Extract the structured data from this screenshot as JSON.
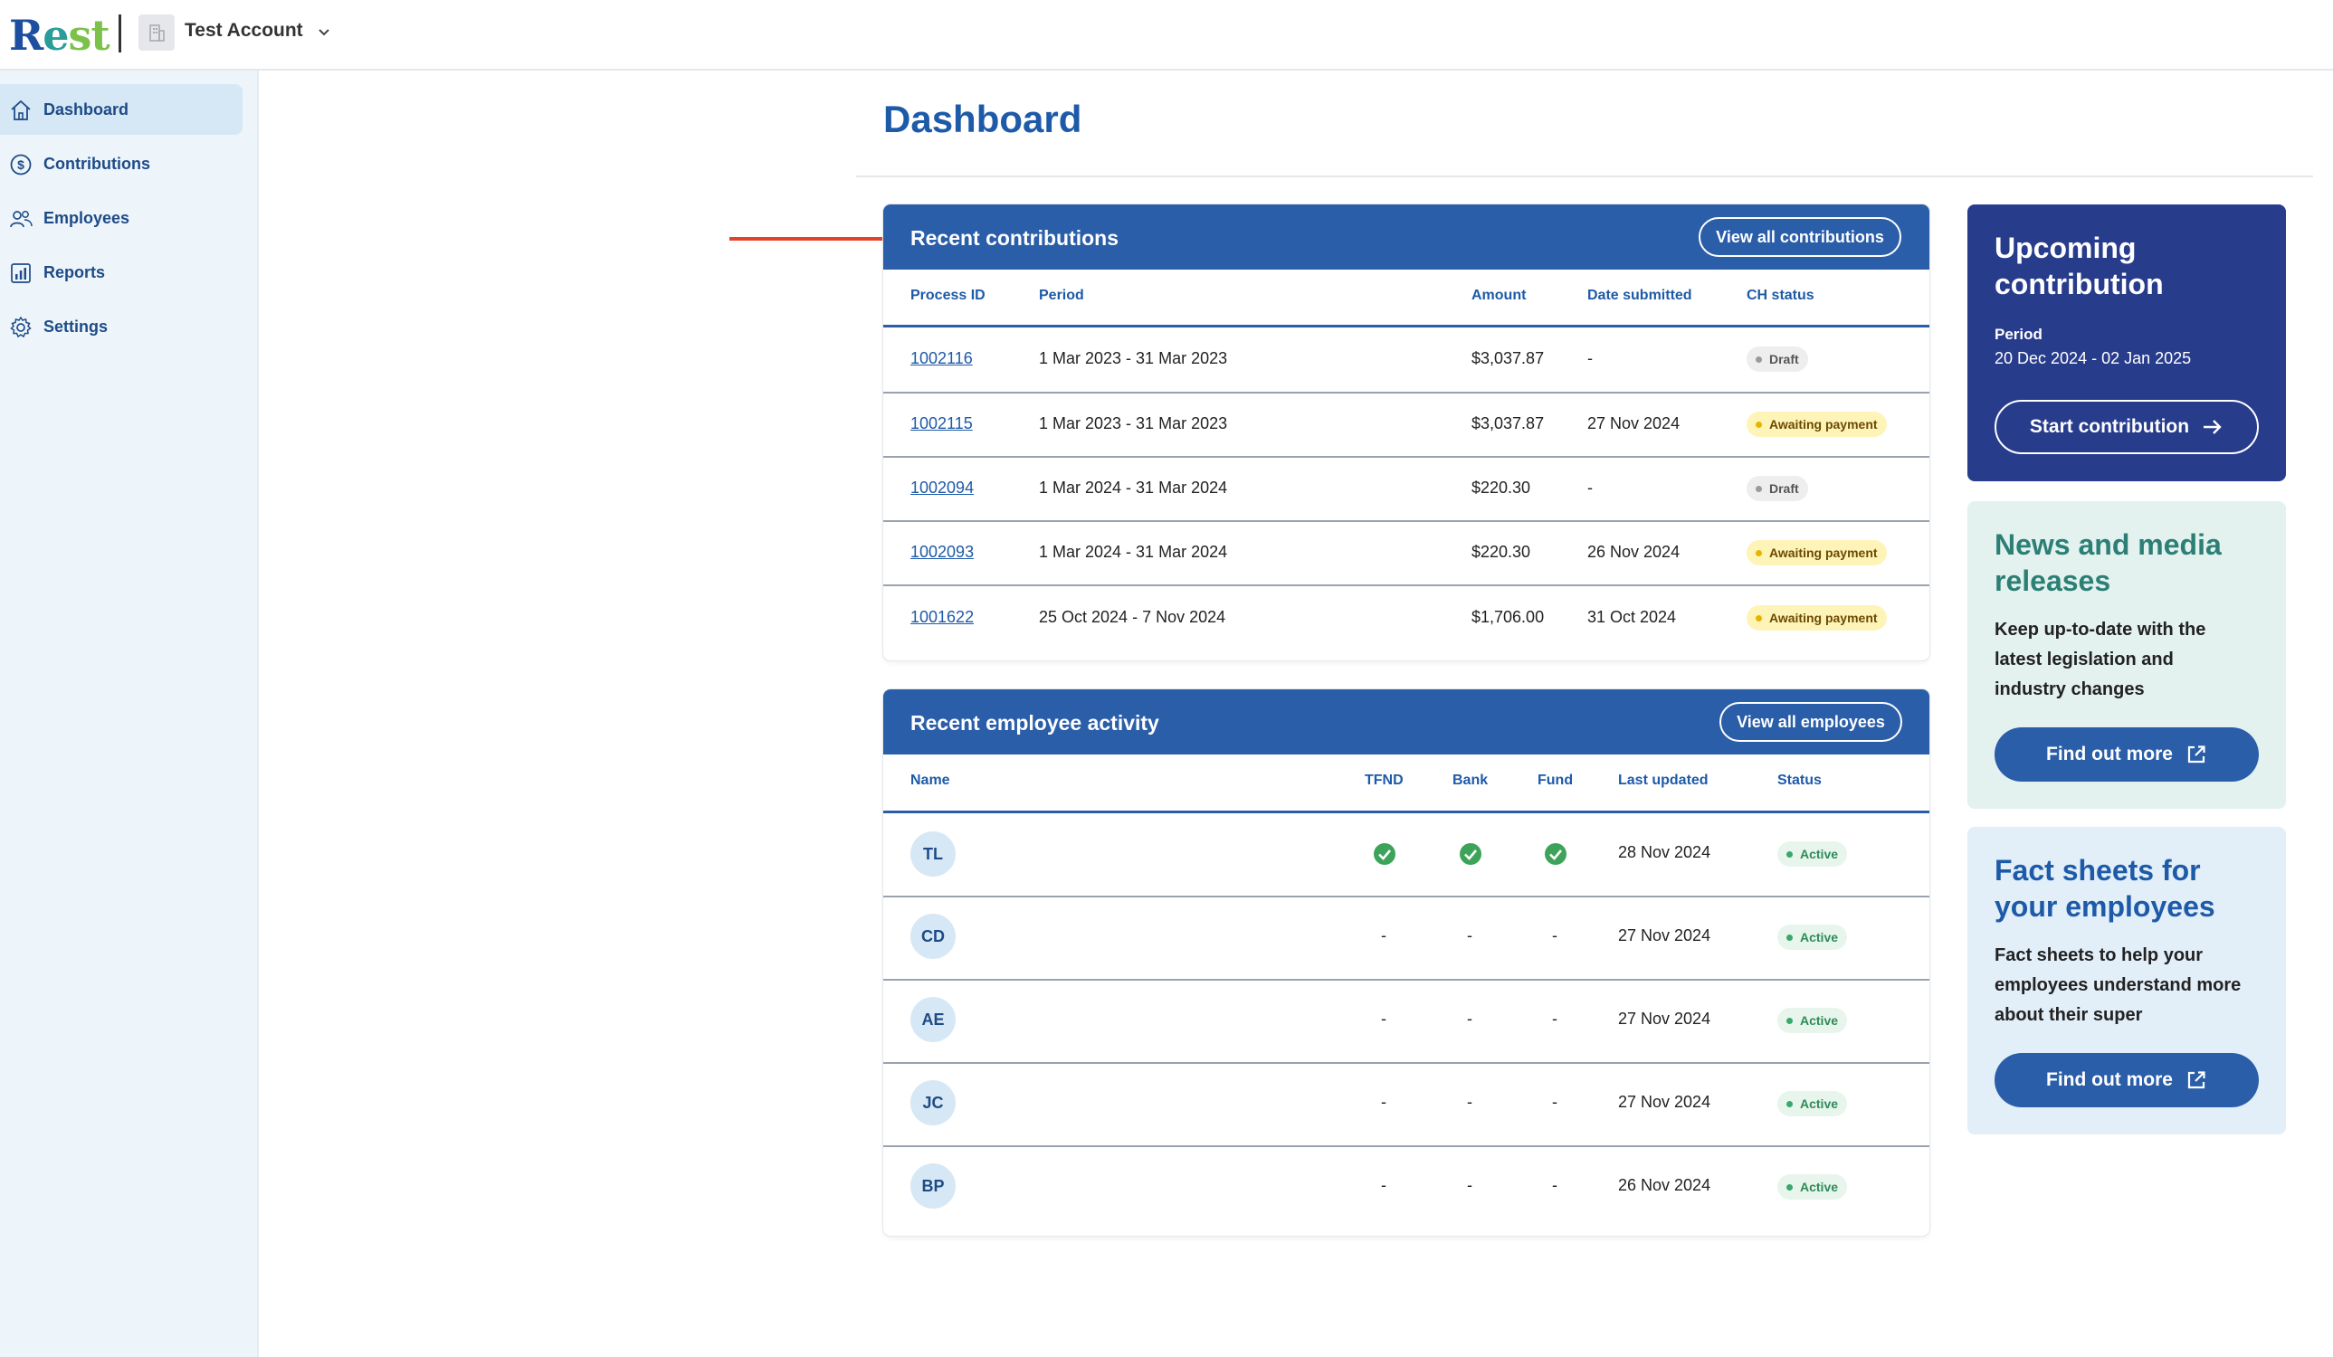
{
  "app": {
    "logo_text_1": "R",
    "logo_text_2": "e",
    "logo_text_3": "st",
    "account_name": "Test Account"
  },
  "sidebar": {
    "items": [
      {
        "label": "Dashboard",
        "icon": "home-icon",
        "active": true
      },
      {
        "label": "Contributions",
        "icon": "dollar-icon",
        "active": false
      },
      {
        "label": "Employees",
        "icon": "people-icon",
        "active": false
      },
      {
        "label": "Reports",
        "icon": "chart-icon",
        "active": false
      },
      {
        "label": "Settings",
        "icon": "gear-icon",
        "active": false
      }
    ]
  },
  "page": {
    "title": "Dashboard"
  },
  "contributions": {
    "title": "Recent contributions",
    "button": "View all contributions",
    "headers": {
      "process_id": "Process ID",
      "period": "Period",
      "amount": "Amount",
      "date_submitted": "Date submitted",
      "ch_status": "CH status"
    },
    "rows": [
      {
        "id": "1002116",
        "period": "1 Mar 2023 - 31 Mar 2023",
        "amount": "$3,037.87",
        "date": "-",
        "status": "Draft"
      },
      {
        "id": "1002115",
        "period": "1 Mar 2023 - 31 Mar 2023",
        "amount": "$3,037.87",
        "date": "27 Nov 2024",
        "status": "Awaiting payment"
      },
      {
        "id": "1002094",
        "period": "1 Mar 2024 - 31 Mar 2024",
        "amount": "$220.30",
        "date": "-",
        "status": "Draft"
      },
      {
        "id": "1002093",
        "period": "1 Mar 2024 - 31 Mar 2024",
        "amount": "$220.30",
        "date": "26 Nov 2024",
        "status": "Awaiting payment"
      },
      {
        "id": "1001622",
        "period": "25 Oct 2024 - 7 Nov 2024",
        "amount": "$1,706.00",
        "date": "31 Oct 2024",
        "status": "Awaiting payment"
      }
    ]
  },
  "employees": {
    "title": "Recent employee activity",
    "button": "View all employees",
    "headers": {
      "name": "Name",
      "tfnd": "TFND",
      "bank": "Bank",
      "fund": "Fund",
      "last_updated": "Last updated",
      "status": "Status"
    },
    "rows": [
      {
        "initials": "TL",
        "tfnd": "check",
        "bank": "check",
        "fund": "check",
        "updated": "28 Nov 2024",
        "status": "Active"
      },
      {
        "initials": "CD",
        "tfnd": "-",
        "bank": "-",
        "fund": "-",
        "updated": "27 Nov 2024",
        "status": "Active"
      },
      {
        "initials": "AE",
        "tfnd": "-",
        "bank": "-",
        "fund": "-",
        "updated": "27 Nov 2024",
        "status": "Active"
      },
      {
        "initials": "JC",
        "tfnd": "-",
        "bank": "-",
        "fund": "-",
        "updated": "27 Nov 2024",
        "status": "Active"
      },
      {
        "initials": "BP",
        "tfnd": "-",
        "bank": "-",
        "fund": "-",
        "updated": "26 Nov 2024",
        "status": "Active"
      }
    ]
  },
  "upcoming": {
    "title_1": "Upcoming",
    "title_2": "contribution",
    "period_label": "Period",
    "period_value": "20 Dec 2024 - 02 Jan 2025",
    "button": "Start contribution"
  },
  "news": {
    "title_1": "News and media",
    "title_2": "releases",
    "text_1": "Keep up-to-date with the",
    "text_2": "latest legislation and",
    "text_3": "industry changes",
    "button": "Find out more"
  },
  "facts": {
    "title_1": "Fact sheets for",
    "title_2": "your employees",
    "text_1": "Fact sheets to help your",
    "text_2": "employees understand more",
    "text_3": "about their super",
    "button": "Find out more"
  },
  "colors": {
    "primary": "#2a5ea9",
    "navy_panel": "#283c8c",
    "news_bg": "#e3f1ef",
    "news_title": "#2c7f74",
    "facts_bg": "#e2eef8",
    "facts_title": "#1d5aa8",
    "arrow": "#e2432a"
  }
}
